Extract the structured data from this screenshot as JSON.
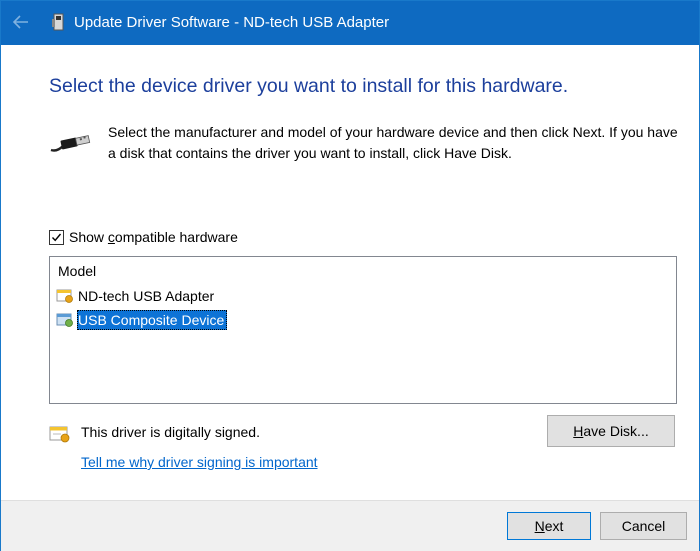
{
  "window": {
    "title": "Update Driver Software - ND-tech USB Adapter",
    "accent_color": "#0e6ac1"
  },
  "main": {
    "heading": "Select the device driver you want to install for this hardware.",
    "instruction": "Select the manufacturer and model of your hardware device and then click Next. If you have a disk that contains the driver you want to install, click Have Disk."
  },
  "compatible": {
    "checked": true,
    "label_pre": "Show ",
    "label_accel": "c",
    "label_post": "ompatible hardware"
  },
  "model_list": {
    "header": "Model",
    "items": [
      {
        "label": "ND-tech USB Adapter",
        "icon": "certified-driver-icon",
        "selected": false
      },
      {
        "label": "USB Composite Device",
        "icon": "usb-device-icon",
        "selected": true
      }
    ]
  },
  "signing": {
    "status": "This driver is digitally signed.",
    "link": "Tell me why driver signing is important"
  },
  "buttons": {
    "have_disk_accel": "H",
    "have_disk_rest": "ave Disk...",
    "next_accel": "N",
    "next_rest": "ext",
    "cancel": "Cancel"
  }
}
